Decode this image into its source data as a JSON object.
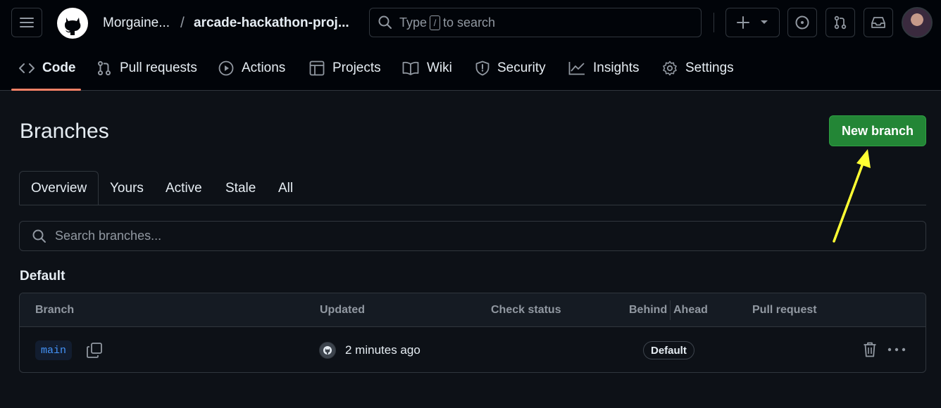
{
  "header": {
    "owner": "Morgaine...",
    "separator": "/",
    "repo": "arcade-hackathon-proj...",
    "search": {
      "prefix": "Type",
      "key": "/",
      "suffix": "to search"
    }
  },
  "nav": {
    "items": [
      {
        "label": "Code",
        "icon": "code-icon"
      },
      {
        "label": "Pull requests",
        "icon": "pull-request-icon"
      },
      {
        "label": "Actions",
        "icon": "play-icon"
      },
      {
        "label": "Projects",
        "icon": "table-icon"
      },
      {
        "label": "Wiki",
        "icon": "book-icon"
      },
      {
        "label": "Security",
        "icon": "shield-icon"
      },
      {
        "label": "Insights",
        "icon": "graph-icon"
      },
      {
        "label": "Settings",
        "icon": "gear-icon"
      }
    ],
    "active": "Code"
  },
  "page": {
    "title": "Branches",
    "new_branch_label": "New branch",
    "tabs": [
      "Overview",
      "Yours",
      "Active",
      "Stale",
      "All"
    ],
    "active_tab": "Overview",
    "search_placeholder": "Search branches...",
    "section_title": "Default"
  },
  "table": {
    "columns": {
      "branch": "Branch",
      "updated": "Updated",
      "check_status": "Check status",
      "behind": "Behind",
      "ahead": "Ahead",
      "pull_request": "Pull request"
    },
    "rows": [
      {
        "branch": "main",
        "updated": "2 minutes ago",
        "badge": "Default"
      }
    ]
  },
  "colors": {
    "accent_green": "#238636",
    "annotation_arrow": "#ffff33",
    "tab_underline": "#f78166",
    "link_blue": "#4493f8"
  }
}
